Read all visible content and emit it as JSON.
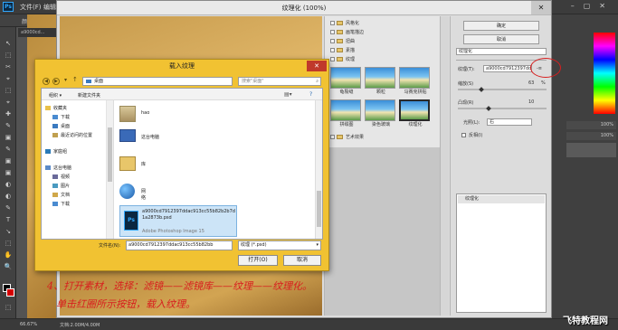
{
  "ps": {
    "logo": "Ps",
    "menu": [
      "文件(F)",
      "编辑"
    ],
    "doc_tab": "a9000cd...",
    "options_bar_text": "颜样式",
    "zoom": "66.67%",
    "doc_size": "文档:2.00M/4.00M",
    "panel_values": [
      "100%",
      "100%"
    ],
    "tools": [
      "↖",
      "⬚",
      "✂",
      "⌖",
      "✎",
      "▣",
      "✚",
      "◐",
      "T",
      "↘",
      "✋",
      "🔍"
    ]
  },
  "filter_gallery": {
    "title": "纹理化 (100%)",
    "close": "✕",
    "categories": [
      "风格化",
      "画笔描边",
      "扭曲",
      "素描",
      "纹理",
      "艺术效果"
    ],
    "thumbnails": [
      {
        "label": "龟裂缝"
      },
      {
        "label": "颗粒"
      },
      {
        "label": "马赛克拼贴"
      },
      {
        "label": "拼缀图"
      },
      {
        "label": "染色玻璃"
      },
      {
        "label": "纹理化"
      }
    ],
    "ok_button": "确定",
    "cancel_button": "取消",
    "select": "纹理化",
    "settings": {
      "texture_label": "纹理(T):",
      "texture_value": "a9000cd7912397dd",
      "menu_button": "-≡",
      "scaling_label": "缩放(S)",
      "scaling_value": "63",
      "scaling_percent": "%",
      "relief_label": "凸现(R)",
      "relief_value": "10",
      "light_label": "光照(L):",
      "light_value": "右",
      "invert_label": "反相(I)"
    },
    "layer_item": "纹理化"
  },
  "load_dialog": {
    "title": "载入纹理",
    "close": "✕",
    "path": "桌面",
    "search_placeholder": "搜索\"桌面\"",
    "toolbar": {
      "organize": "组织 ▾",
      "new_folder": "新建文件夹"
    },
    "nav_items": [
      {
        "label": "收藏夹",
        "color": "#e8c04a"
      },
      {
        "label": "下载",
        "color": "#4a8bd0"
      },
      {
        "label": "桌面",
        "color": "#3a7ac0"
      },
      {
        "label": "最近访问的位置",
        "color": "#c0a050"
      },
      {
        "label": "家庭组",
        "color": "#2a7ab8"
      },
      {
        "label": "这台电脑",
        "color": "#5a8ac8"
      },
      {
        "label": "视频",
        "color": "#6a6a9a"
      },
      {
        "label": "图片",
        "color": "#4a9ac0"
      },
      {
        "label": "文档",
        "color": "#d0a84a"
      },
      {
        "label": "下载",
        "color": "#4a8bd0"
      }
    ],
    "files": [
      {
        "name": "hao"
      },
      {
        "name": "这台电脑"
      },
      {
        "name": "库"
      },
      {
        "name": "网络"
      }
    ],
    "selected_file": {
      "name": "a9000cd7912397ddac913cc55b82b2b7d1a2873b.psd",
      "type": "Adobe Photoshop Image 15"
    },
    "filename_label": "文件名(N):",
    "filename_value": "a9000cd7912397ddac913cc55b82bb",
    "filetype_value": "纹理 (*.psd)",
    "open_button": "打开(O)",
    "cancel_button": "取消"
  },
  "annotations": {
    "line1": "4、打开素材，选择：滤镜——滤镜库——纹理——纹理化。",
    "line2": "单击红圈所示按钮，载入纹理。",
    "watermark": "飞特教程网"
  }
}
